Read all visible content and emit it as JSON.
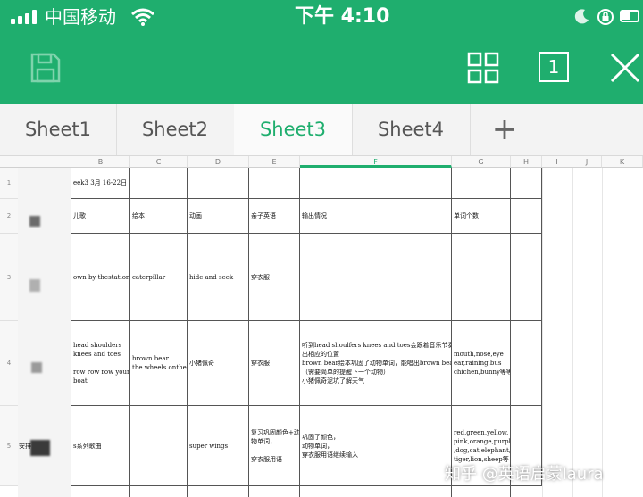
{
  "status_bar": {
    "carrier": "中国移动",
    "time": "下午 4:10"
  },
  "toolbar": {
    "sheet_count": "1"
  },
  "tabs": [
    {
      "label": "Sheet1",
      "active": false
    },
    {
      "label": "Sheet2",
      "active": false
    },
    {
      "label": "Sheet3",
      "active": true
    },
    {
      "label": "Sheet4",
      "active": false
    }
  ],
  "add_sheet_label": "+",
  "sheet": {
    "columns": [
      "B",
      "C",
      "D",
      "E",
      "F",
      "G",
      "H",
      "I",
      "J",
      "K"
    ],
    "selected_column": "F",
    "row_numbers": [
      "1",
      "2",
      "3",
      "4",
      "5"
    ],
    "row5_label": "安排",
    "cells": {
      "b1": "eek3 3月 16-22日",
      "b2": "儿歌",
      "c2": "绘本",
      "d2": "动画",
      "e2": "亲子英语",
      "f2": "输出情况",
      "g2": "单词个数",
      "b3": "own by thestation",
      "c3": "caterpillar",
      "d3": "hide and seek",
      "e3": "穿衣服",
      "b4": [
        "head shoulders",
        "knees and toes",
        "",
        "row row row your",
        "boat"
      ],
      "c4": [
        "brown bear",
        "the wheels onthe bus"
      ],
      "d4": "小猪佩奇",
      "e4": "穿衣服",
      "f4": [
        "听到head shoulfers knees and toes会跟着音乐节奏一起指",
        "出相应的位置",
        "brown bear绘本巩固了动物单词，能唱出brown bear歌曲",
        "（需要简单的提醒下一个动物）",
        "小猪佩奇泥坑了解天气"
      ],
      "g4": [
        "mouth,nose,eye",
        "ear,raining,bus",
        "chichen,bunny等等"
      ],
      "b5": "s系列歌曲",
      "d5": "super wings",
      "e5": [
        "复习巩固颜色+动",
        "物单词，",
        "",
        "穿衣服用语"
      ],
      "f5": [
        "巩固了颜色，",
        "动物单词，",
        "穿衣服用语继续输入"
      ],
      "g5": [
        "red,green,yellow,",
        "pink,orange,purple+pig",
        ",dog,cat,elephant,duck,",
        "tiger,lion,sheep等"
      ]
    }
  },
  "watermark": "知乎 @英语启蒙laura",
  "colors": {
    "accent": "#1fae6e",
    "tab_bar": "#f3f3f3"
  }
}
